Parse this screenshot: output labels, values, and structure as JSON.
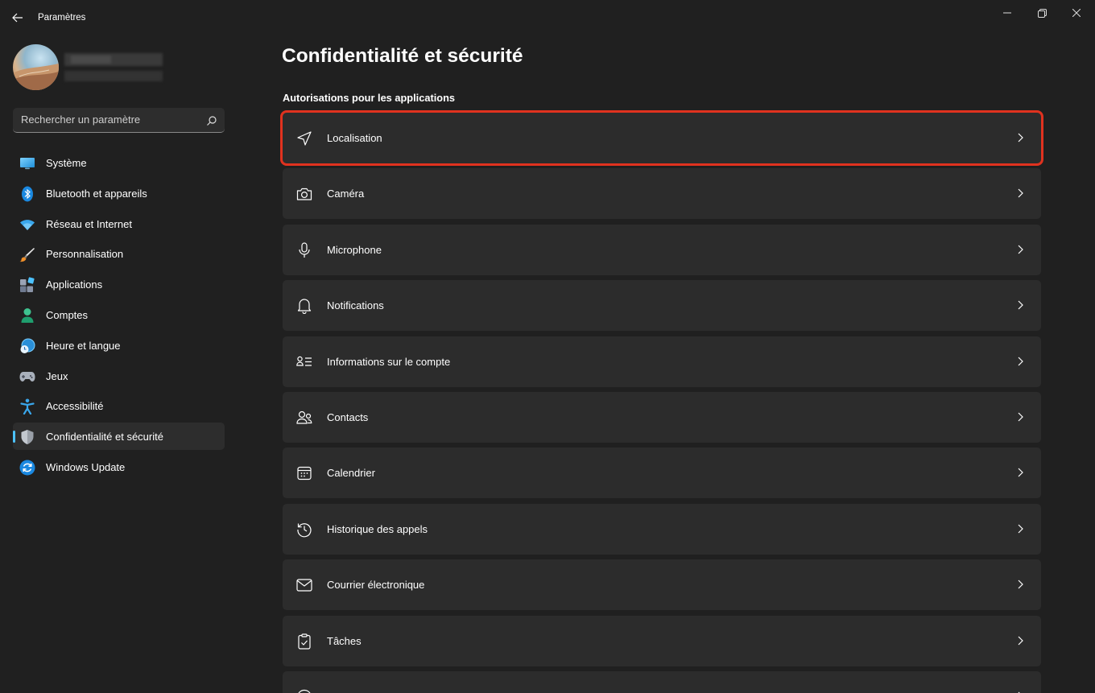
{
  "window": {
    "title": "Paramètres"
  },
  "sidebar": {
    "search_placeholder": "Rechercher un paramètre",
    "items": [
      {
        "label": "Système",
        "icon": "monitor-icon",
        "selected": false
      },
      {
        "label": "Bluetooth et appareils",
        "icon": "bluetooth-icon",
        "selected": false
      },
      {
        "label": "Réseau et Internet",
        "icon": "wifi-icon",
        "selected": false
      },
      {
        "label": "Personnalisation",
        "icon": "brush-icon",
        "selected": false
      },
      {
        "label": "Applications",
        "icon": "apps-icon",
        "selected": false
      },
      {
        "label": "Comptes",
        "icon": "person-icon",
        "selected": false
      },
      {
        "label": "Heure et langue",
        "icon": "clock-globe-icon",
        "selected": false
      },
      {
        "label": "Jeux",
        "icon": "gamepad-icon",
        "selected": false
      },
      {
        "label": "Accessibilité",
        "icon": "accessibility-icon",
        "selected": false
      },
      {
        "label": "Confidentialité et sécurité",
        "icon": "shield-icon",
        "selected": true
      },
      {
        "label": "Windows Update",
        "icon": "update-icon",
        "selected": false
      }
    ]
  },
  "main": {
    "title": "Confidentialité et sécurité",
    "section": "Autorisations pour les applications",
    "items": [
      {
        "label": "Localisation",
        "icon": "location-arrow-icon",
        "highlighted": true
      },
      {
        "label": "Caméra",
        "icon": "camera-icon",
        "highlighted": false
      },
      {
        "label": "Microphone",
        "icon": "microphone-icon",
        "highlighted": false
      },
      {
        "label": "Notifications",
        "icon": "bell-icon",
        "highlighted": false
      },
      {
        "label": "Informations sur le compte",
        "icon": "account-info-icon",
        "highlighted": false
      },
      {
        "label": "Contacts",
        "icon": "contacts-icon",
        "highlighted": false
      },
      {
        "label": "Calendrier",
        "icon": "calendar-icon",
        "highlighted": false
      },
      {
        "label": "Historique des appels",
        "icon": "history-icon",
        "highlighted": false
      },
      {
        "label": "Courrier électronique",
        "icon": "mail-icon",
        "highlighted": false
      },
      {
        "label": "Tâches",
        "icon": "tasks-icon",
        "highlighted": false
      },
      {
        "label": "",
        "icon": "message-icon",
        "highlighted": false
      }
    ]
  },
  "colors": {
    "background": "#202020",
    "card": "#2c2c2c",
    "accent": "#4cc2ff",
    "highlight_border": "#e0321f"
  }
}
